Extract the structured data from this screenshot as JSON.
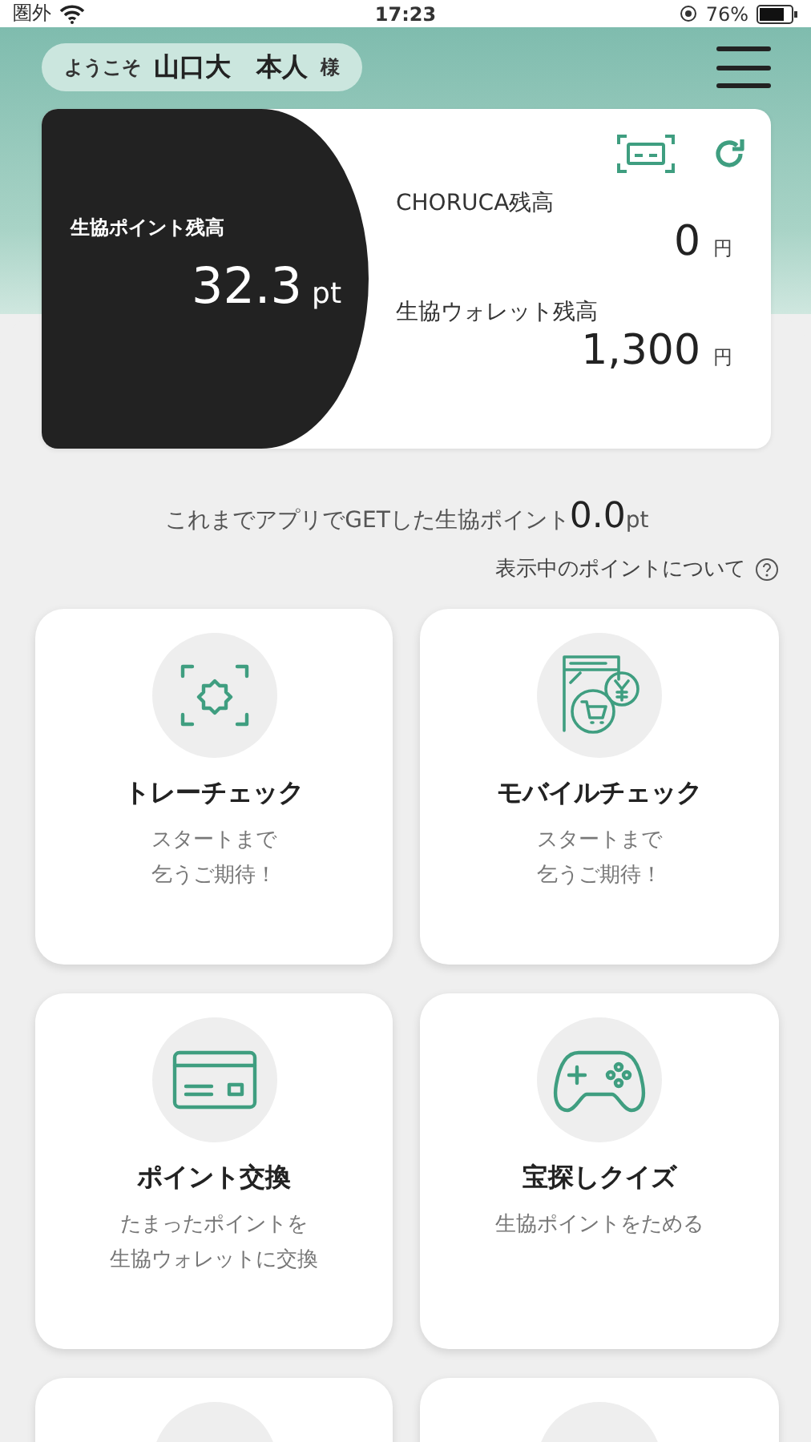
{
  "status_bar": {
    "carrier": "圏外",
    "time": "17:23",
    "battery": "76%"
  },
  "header": {
    "greeting": "ようこそ",
    "name": "山口大　本人",
    "honorific": "様"
  },
  "balance_card": {
    "points_label": "生協ポイント残高",
    "points_value": "32.3",
    "points_unit": "pt",
    "balances": [
      {
        "label": "CHORUCA残高",
        "value": "0",
        "unit": "円"
      },
      {
        "label": "生協ウォレット残高",
        "value": "1,300",
        "unit": "円"
      }
    ]
  },
  "earned": {
    "label": "これまでアプリでGETした生協ポイント",
    "value": "0.0",
    "unit": "pt"
  },
  "about_link": "表示中のポイントについて",
  "tiles": [
    {
      "kind": "tray",
      "title": "トレーチェック",
      "description": [
        "スタートまで",
        "乞うご期待！"
      ]
    },
    {
      "kind": "mobile",
      "title": "モバイルチェック",
      "description": [
        "スタートまで",
        "乞うご期待！"
      ]
    },
    {
      "kind": "exchange",
      "title": "ポイント交換",
      "description": [
        "たまったポイントを",
        "生協ウォレットに交換"
      ]
    },
    {
      "kind": "quiz",
      "title": "宝探しクイズ",
      "description": [
        "生協ポイントをためる"
      ]
    },
    {
      "kind": "partial"
    },
    {
      "kind": "partial"
    }
  ]
}
